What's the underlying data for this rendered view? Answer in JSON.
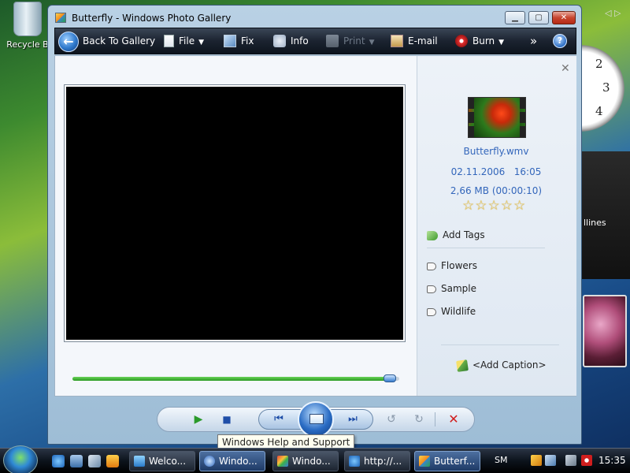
{
  "desktop": {
    "recycle_bin_label": "Recycle B",
    "feed_gadget_text": "llines",
    "clock_numbers": [
      "2",
      "3",
      "4"
    ]
  },
  "window": {
    "title": "Butterfly - Windows Photo Gallery"
  },
  "toolbar": {
    "back_label": "Back To Gallery",
    "file_label": "File",
    "fix_label": "Fix",
    "info_label": "Info",
    "print_label": "Print",
    "email_label": "E-mail",
    "burn_label": "Burn",
    "more_glyph": "»",
    "help_glyph": "?"
  },
  "player": {
    "progress_fraction": 0.98
  },
  "info_pane": {
    "filename": "Butterfly.wmv",
    "date": "02.11.2006",
    "time": "16:05",
    "size_duration": "2,66 MB (00:00:10)",
    "rating_stars": "☆☆☆☆☆",
    "add_tags_label": "Add Tags",
    "tags": [
      "Flowers",
      "Sample",
      "Wildlife"
    ],
    "add_caption_label": "<Add Caption>"
  },
  "tooltip": "Windows Help and Support",
  "taskbar": {
    "tasks": [
      {
        "label": "Welco..."
      },
      {
        "label": "Windo..."
      },
      {
        "label": "Windo..."
      },
      {
        "label": "http://..."
      },
      {
        "label": "Butterf..."
      }
    ],
    "language": "SM",
    "clock": "15:35"
  },
  "colors": {
    "accent_link": "#3366bb",
    "progress_green": "#2a9a22",
    "delete_red": "#d01e1e"
  }
}
